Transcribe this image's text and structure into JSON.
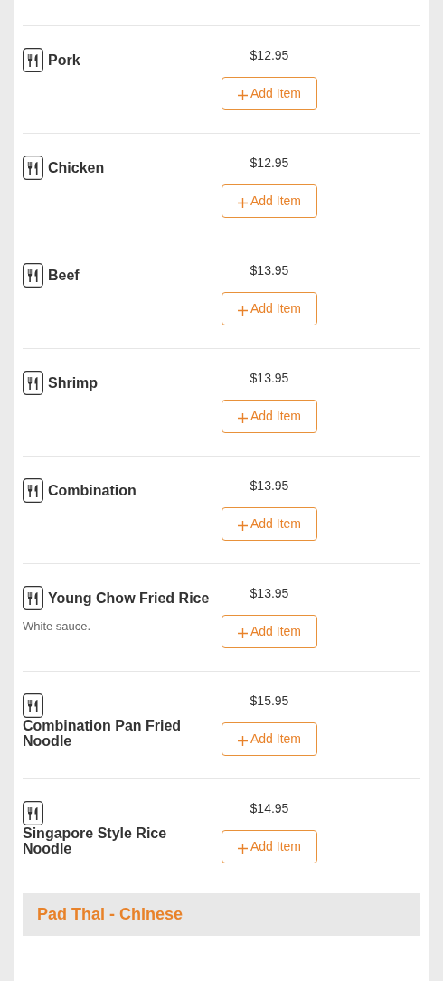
{
  "items": [
    {
      "name": "Pork",
      "price": "$12.95",
      "button": "Add Item"
    },
    {
      "name": "Chicken",
      "price": "$12.95",
      "button": "Add Item"
    },
    {
      "name": "Beef",
      "price": "$13.95",
      "button": "Add Item"
    },
    {
      "name": "Shrimp",
      "price": "$13.95",
      "button": "Add Item"
    },
    {
      "name": "Combination",
      "price": "$13.95",
      "button": "Add Item"
    },
    {
      "name": "Young Chow Fried Rice",
      "description": "White sauce.",
      "price": "$13.95",
      "button": "Add Item"
    },
    {
      "name": "Combination Pan Fried Noodle",
      "price": "$15.95",
      "button": "Add Item"
    },
    {
      "name": "Singapore Style Rice Noodle",
      "price": "$14.95",
      "button": "Add Item"
    }
  ],
  "section_header": "Pad Thai - Chinese"
}
